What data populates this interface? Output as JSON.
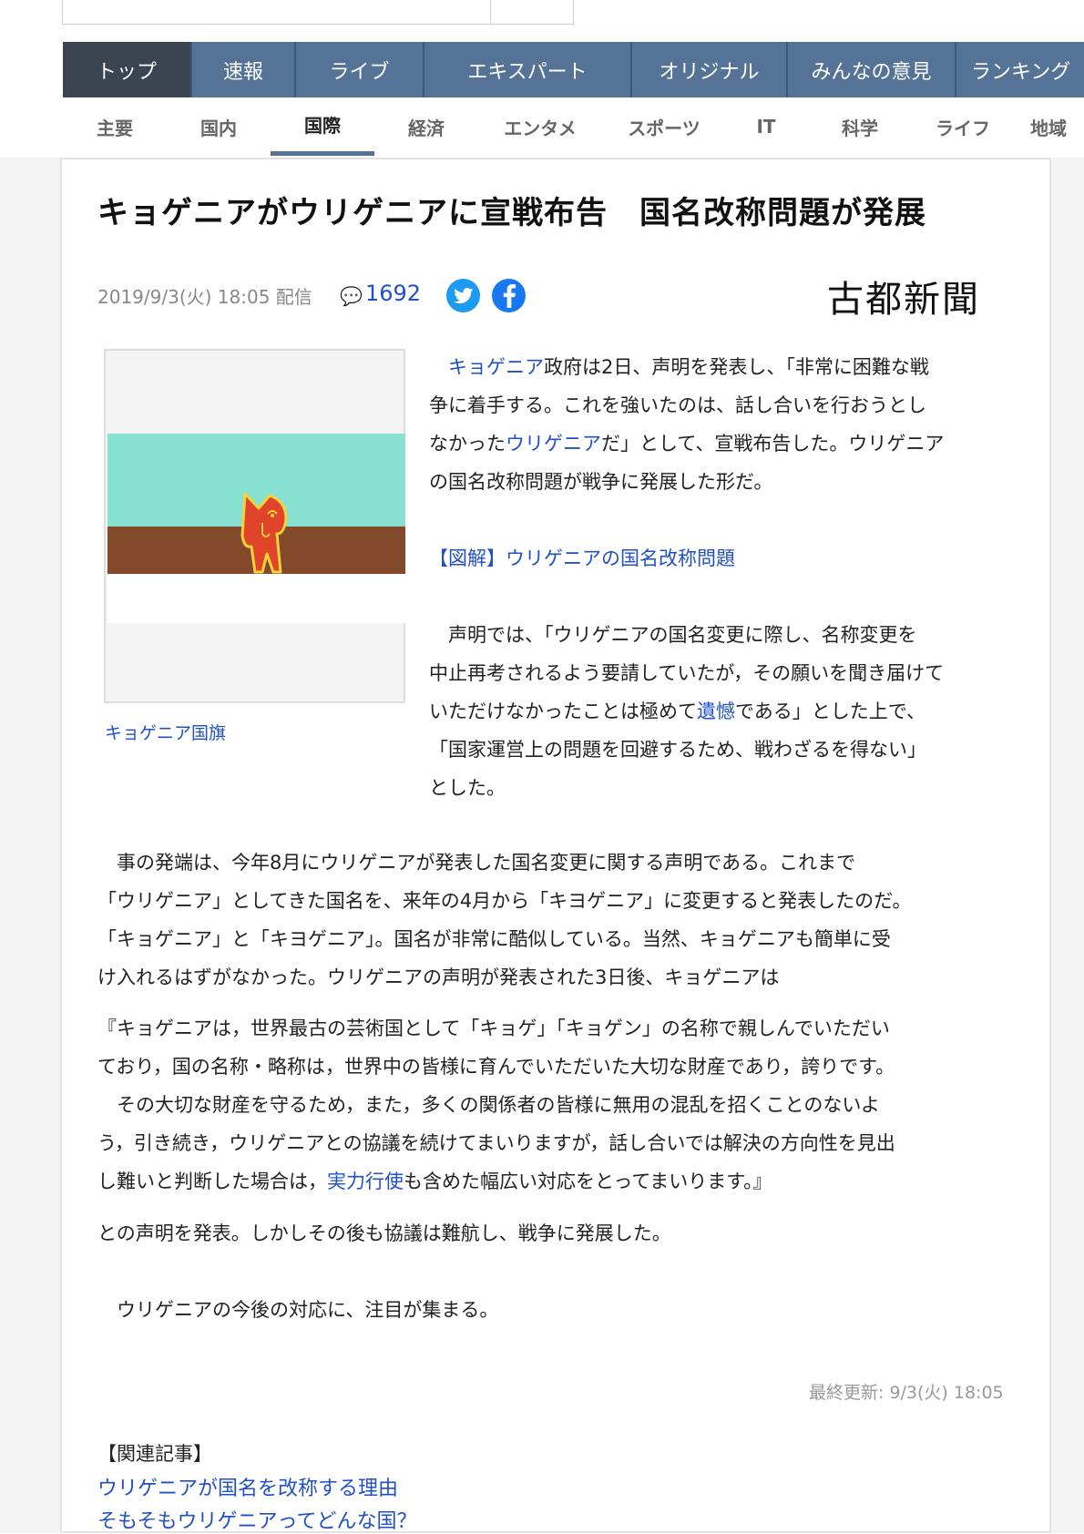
{
  "global_nav": {
    "items": [
      {
        "label": "トップ",
        "active": true
      },
      {
        "label": "速報"
      },
      {
        "label": "ライブ"
      },
      {
        "label": "エキスパート"
      },
      {
        "label": "オリジナル"
      },
      {
        "label": "みんなの意見"
      },
      {
        "label": "ランキング"
      }
    ]
  },
  "category_nav": {
    "items": [
      {
        "label": "主要"
      },
      {
        "label": "国内"
      },
      {
        "label": "国際",
        "active": true
      },
      {
        "label": "経済"
      },
      {
        "label": "エンタメ"
      },
      {
        "label": "スポーツ"
      },
      {
        "label": "IT"
      },
      {
        "label": "科学"
      },
      {
        "label": "ライフ"
      },
      {
        "label": "地域"
      }
    ]
  },
  "article": {
    "title": "キョゲニアがウリゲニアに宣戦布告　国名改称問題が発展",
    "meta": "2019/9/3(火) 18:05 配信",
    "comment_icon": "comment-icon",
    "comment_count": "1692",
    "publisher": "古都新聞",
    "image_caption": "キョゲニア国旗",
    "p1": {
      "indent": "　",
      "link1": "キョゲニア",
      "l1": "政府は2日、声明を発表し、「非常に困難な戦",
      "l2": "争に着手する。これを強いたのは、話し合いを行おうとし",
      "l3a": "なかった",
      "link2": "ウリゲニア",
      "l3b": "だ」として、宣戦布告した。ウリゲニア",
      "l4": "の国名改称問題が戦争に発展した形だ。"
    },
    "figure_link": "【図解】ウリゲニアの国名改称問題",
    "p3": {
      "l1": "　声明では、「ウリゲニアの国名変更に際し、名称変更を",
      "l2": "中止再考されるよう要請していたが，その願いを聞き届けて",
      "l3a": "いただけなかったことは極めて",
      "link": "遺憾",
      "l3b": "である」とした上で、",
      "l4": "「国家運営上の問題を回避するため、戦わざるを得ない」",
      "l5": "とした。"
    },
    "p4": {
      "l1": "　事の発端は、今年8月にウリゲニアが発表した国名変更に関する声明である。これまで",
      "l2": "「ウリゲニア」としてきた国名を、来年の4月から「キヨゲニア」に変更すると発表したのだ。",
      "l3": "「キョゲニア」と「キヨゲニア」。国名が非常に酷似している。当然、キョゲニアも簡単に受",
      "l4": "け入れるはずがなかった。ウリゲニアの声明が発表された3日後、キョゲニアは"
    },
    "p5": {
      "l1": "『キョゲニアは，世界最古の芸術国として「キョゲ」「キョゲン」の名称で親しんでいただい",
      "l2": "ており，国の名称・略称は，世界中の皆様に育んでいただいた大切な財産であり，誇りです。",
      "l3": "　その大切な財産を守るため，また，多くの関係者の皆様に無用の混乱を招くことのないよ",
      "l4": "う，引き続き，ウリゲニアとの協議を続けてまいりますが，話し合いでは解決の方向性を見出",
      "l5a": "し難いと判断した場合は，",
      "link": "実力行使",
      "l5b": "も含めた幅広い対応をとってまいります。』"
    },
    "p6": "との声明を発表。しかしその後も協議は難航し、戦争に発展した。",
    "p7": "　ウリゲニアの今後の対応に、注目が集まる。",
    "updated": "最終更新: 9/3(火) 18:05",
    "related_heading": "【関連記事】",
    "related_links": [
      "ウリゲニアが国名を改称する理由",
      "そもそもウリゲニアってどんな国？"
    ]
  },
  "flag_colors": {
    "sky": "#87e0d0",
    "ground": "#82492a",
    "figure": "#e0452a",
    "outline": "#f5d23c"
  }
}
